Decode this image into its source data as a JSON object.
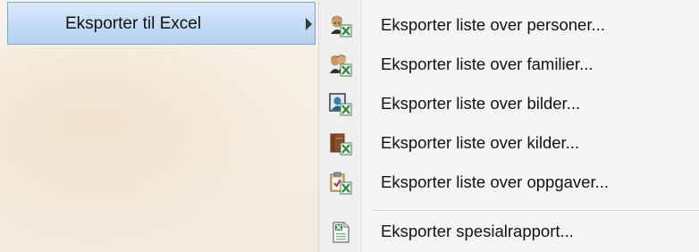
{
  "parent_menu": {
    "label": "Eksporter til Excel",
    "has_submenu": true,
    "highlight_color": "#c5dcf6"
  },
  "submenu": {
    "items": [
      {
        "label": "Eksporter liste over personer...",
        "icon": "person-excel-icon"
      },
      {
        "label": "Eksporter liste over familier...",
        "icon": "family-excel-icon"
      },
      {
        "label": "Eksporter liste over bilder...",
        "icon": "picture-excel-icon"
      },
      {
        "label": "Eksporter liste over kilder...",
        "icon": "source-book-excel-icon"
      },
      {
        "label": "Eksporter liste over oppgaver...",
        "icon": "task-clipboard-excel-icon"
      }
    ],
    "special_item": {
      "label": "Eksporter spesialrapport...",
      "icon": "excel-document-icon"
    }
  },
  "colors": {
    "excel_green": "#2e8b3a",
    "submenu_bg": "#f5f5f5"
  }
}
